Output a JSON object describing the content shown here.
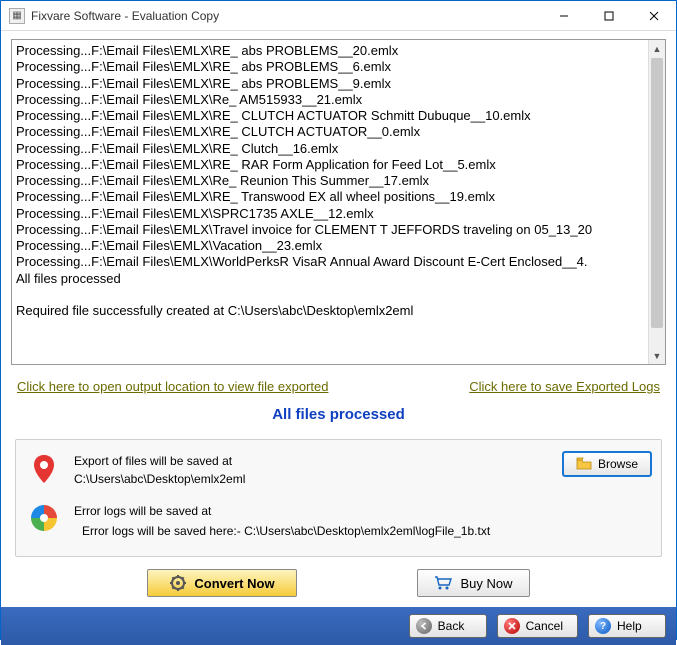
{
  "window": {
    "title": "Fixvare Software - Evaluation Copy"
  },
  "log": {
    "lines": [
      "Processing...F:\\Email Files\\EMLX\\RE_ abs PROBLEMS__20.emlx",
      "Processing...F:\\Email Files\\EMLX\\RE_ abs PROBLEMS__6.emlx",
      "Processing...F:\\Email Files\\EMLX\\RE_ abs PROBLEMS__9.emlx",
      "Processing...F:\\Email Files\\EMLX\\Re_ AM515933__21.emlx",
      "Processing...F:\\Email Files\\EMLX\\RE_ CLUTCH ACTUATOR Schmitt Dubuque__10.emlx",
      "Processing...F:\\Email Files\\EMLX\\RE_ CLUTCH ACTUATOR__0.emlx",
      "Processing...F:\\Email Files\\EMLX\\RE_ Clutch__16.emlx",
      "Processing...F:\\Email Files\\EMLX\\RE_ RAR Form Application for Feed Lot__5.emlx",
      "Processing...F:\\Email Files\\EMLX\\Re_ Reunion This Summer__17.emlx",
      "Processing...F:\\Email Files\\EMLX\\RE_ Transwood EX all wheel positions__19.emlx",
      "Processing...F:\\Email Files\\EMLX\\SPRC1735 AXLE__12.emlx",
      "Processing...F:\\Email Files\\EMLX\\Travel invoice for CLEMENT T JEFFORDS traveling on 05_13_20",
      "Processing...F:\\Email Files\\EMLX\\Vacation__23.emlx",
      "Processing...F:\\Email Files\\EMLX\\WorldPerksR VisaR Annual Award Discount E-Cert Enclosed__4.",
      "All files processed",
      "",
      "Required file successfully created at C:\\Users\\abc\\Desktop\\emlx2eml"
    ]
  },
  "links": {
    "open_output": "Click here to open output location to view file exported",
    "save_logs": "Click here to save Exported Logs"
  },
  "status": "All files processed",
  "export": {
    "label": "Export of files will be saved at",
    "path": "C:\\Users\\abc\\Desktop\\emlx2eml",
    "browse": "Browse"
  },
  "errorlog": {
    "label": "Error logs will be saved at",
    "path": "Error logs will be saved here:- C:\\Users\\abc\\Desktop\\emlx2eml\\logFile_1b.txt"
  },
  "actions": {
    "convert": "Convert Now",
    "buy": "Buy Now"
  },
  "footer": {
    "back": "Back",
    "cancel": "Cancel",
    "help": "Help"
  }
}
